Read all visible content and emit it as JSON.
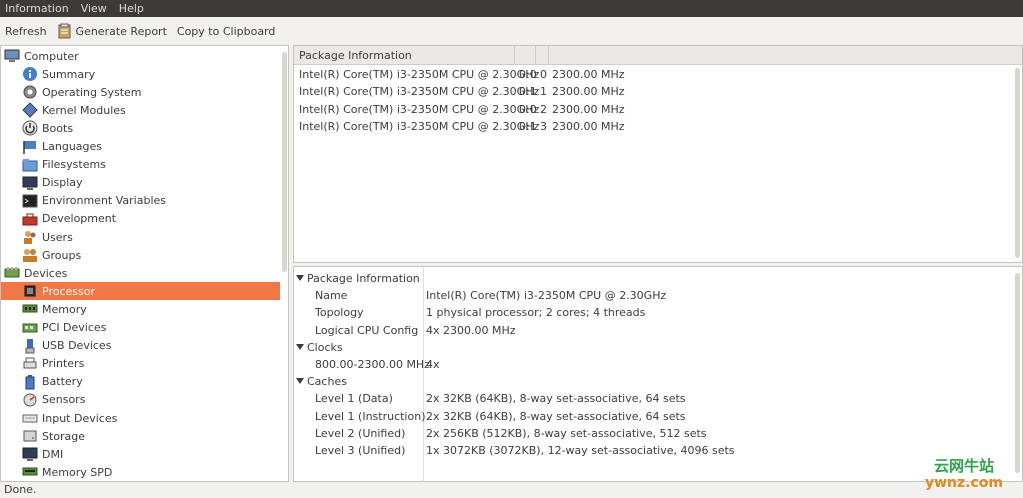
{
  "menu": {
    "items": [
      "Information",
      "View",
      "Help"
    ]
  },
  "toolbar": {
    "refresh_label": "Refresh",
    "report_label": "Generate Report",
    "clipboard_label": "Copy to Clipboard"
  },
  "sidebar": {
    "items": [
      {
        "label": "Computer",
        "icon": "computer-icon",
        "level": 0
      },
      {
        "label": "Summary",
        "icon": "info-icon",
        "level": 1
      },
      {
        "label": "Operating System",
        "icon": "os-icon",
        "level": 1
      },
      {
        "label": "Kernel Modules",
        "icon": "kernel-icon",
        "level": 1
      },
      {
        "label": "Boots",
        "icon": "power-icon",
        "level": 1
      },
      {
        "label": "Languages",
        "icon": "flag-icon",
        "level": 1
      },
      {
        "label": "Filesystems",
        "icon": "folder-icon",
        "level": 1
      },
      {
        "label": "Display",
        "icon": "monitor-icon",
        "level": 1
      },
      {
        "label": "Environment Variables",
        "icon": "terminal-icon",
        "level": 1
      },
      {
        "label": "Development",
        "icon": "toolbox-icon",
        "level": 1
      },
      {
        "label": "Users",
        "icon": "users-icon",
        "level": 1
      },
      {
        "label": "Groups",
        "icon": "groups-icon",
        "level": 1
      },
      {
        "label": "Devices",
        "icon": "devices-icon",
        "level": 0
      },
      {
        "label": "Processor",
        "icon": "cpu-icon",
        "level": 1,
        "selected": true
      },
      {
        "label": "Memory",
        "icon": "ram-icon",
        "level": 1
      },
      {
        "label": "PCI Devices",
        "icon": "pci-icon",
        "level": 1
      },
      {
        "label": "USB Devices",
        "icon": "usb-icon",
        "level": 1
      },
      {
        "label": "Printers",
        "icon": "printer-icon",
        "level": 1
      },
      {
        "label": "Battery",
        "icon": "battery-icon",
        "level": 1
      },
      {
        "label": "Sensors",
        "icon": "sensor-icon",
        "level": 1
      },
      {
        "label": "Input Devices",
        "icon": "keyboard-icon",
        "level": 1
      },
      {
        "label": "Storage",
        "icon": "storage-icon",
        "level": 1
      },
      {
        "label": "DMI",
        "icon": "dmi-icon",
        "level": 1
      },
      {
        "label": "Memory SPD",
        "icon": "spd-icon",
        "level": 1
      }
    ]
  },
  "package_table": {
    "header": "Package Information",
    "rows": [
      [
        "Intel(R) Core(TM) i3-2350M CPU @ 2.30GHz",
        "0:0",
        "0",
        "2300.00 MHz"
      ],
      [
        "Intel(R) Core(TM) i3-2350M CPU @ 2.30GHz",
        "0:1",
        "1",
        "2300.00 MHz"
      ],
      [
        "Intel(R) Core(TM) i3-2350M CPU @ 2.30GHz",
        "0:0",
        "2",
        "2300.00 MHz"
      ],
      [
        "Intel(R) Core(TM) i3-2350M CPU @ 2.30GHz",
        "0:1",
        "3",
        "2300.00 MHz"
      ]
    ]
  },
  "details": [
    {
      "type": "section",
      "label": "Package Information"
    },
    {
      "type": "item",
      "key": "Name",
      "value": "Intel(R) Core(TM) i3-2350M CPU @ 2.30GHz"
    },
    {
      "type": "item",
      "key": "Topology",
      "value": "1 physical processor; 2 cores; 4 threads"
    },
    {
      "type": "item",
      "key": "Logical CPU Config",
      "value": "4x 2300.00 MHz"
    },
    {
      "type": "section",
      "label": "Clocks"
    },
    {
      "type": "item",
      "key": "800.00-2300.00 MHz",
      "value": "4x"
    },
    {
      "type": "section",
      "label": "Caches"
    },
    {
      "type": "item",
      "key": "Level 1 (Data)",
      "value": "2x 32KB (64KB), 8-way set-associative, 64 sets"
    },
    {
      "type": "item",
      "key": "Level 1 (Instruction)",
      "value": "2x 32KB (64KB), 8-way set-associative, 64 sets"
    },
    {
      "type": "item",
      "key": "Level 2 (Unified)",
      "value": "2x 256KB (512KB), 8-way set-associative, 512 sets"
    },
    {
      "type": "item",
      "key": "Level 3 (Unified)",
      "value": "1x 3072KB (3072KB), 12-way set-associative, 4096 sets"
    }
  ],
  "status": {
    "text": "Done."
  },
  "watermark": {
    "line1": "云网牛站",
    "line2": "ywnz.com"
  },
  "colors": {
    "selected": "#f07746",
    "menubar": "#3c3b37"
  }
}
